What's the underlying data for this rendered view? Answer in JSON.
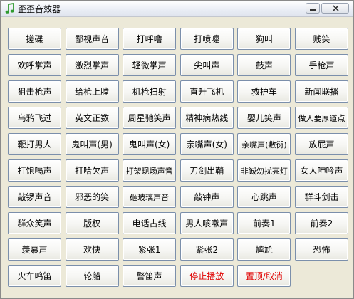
{
  "window": {
    "title": "歪歪音效器"
  },
  "icons": {
    "app": "music-note-icon",
    "minimize": "minimize-icon",
    "close": "close-icon"
  },
  "accent_colors": {
    "stop_text": "#e00000"
  },
  "buttons": [
    "搓碟",
    "鄙视声音",
    "打呼噜",
    "打喷嚏",
    "狗叫",
    "贱笑",
    "欢呼掌声",
    "激烈掌声",
    "轻微掌声",
    "尖叫声",
    "鼓声",
    "手枪声",
    "狙击枪声",
    "给枪上膛",
    "机枪扫射",
    "直升飞机",
    "救护车",
    "新闻联播",
    "乌鸦飞过",
    "英文正数",
    "周星驰笑声",
    "精神病热线",
    "婴儿笑声",
    "做人要厚道点",
    "鞭打男人",
    "鬼叫声(男)",
    "鬼叫声(女)",
    "亲嘴声(女)",
    "亲嘴声(敷衍)",
    "放屁声",
    "打饱嗝声",
    "打哈欠声",
    "打架现场声音",
    "刀剑出鞘",
    "非诚勿扰亮灯",
    "女人呻吟声",
    "敲锣声音",
    "邪恶的笑",
    "砸玻璃声音",
    "敲钟声",
    "心跳声",
    "群斗剑击",
    "群众笑声",
    "版权",
    "电话占线",
    "男人咳嗽声",
    "前奏1",
    "前奏2",
    "羡慕声",
    "欢快",
    "紧张1",
    "紧张2",
    "尴尬",
    "恐怖",
    "火车鸣笛",
    "轮船",
    "警笛声",
    "停止播放",
    "置顶/取消"
  ]
}
